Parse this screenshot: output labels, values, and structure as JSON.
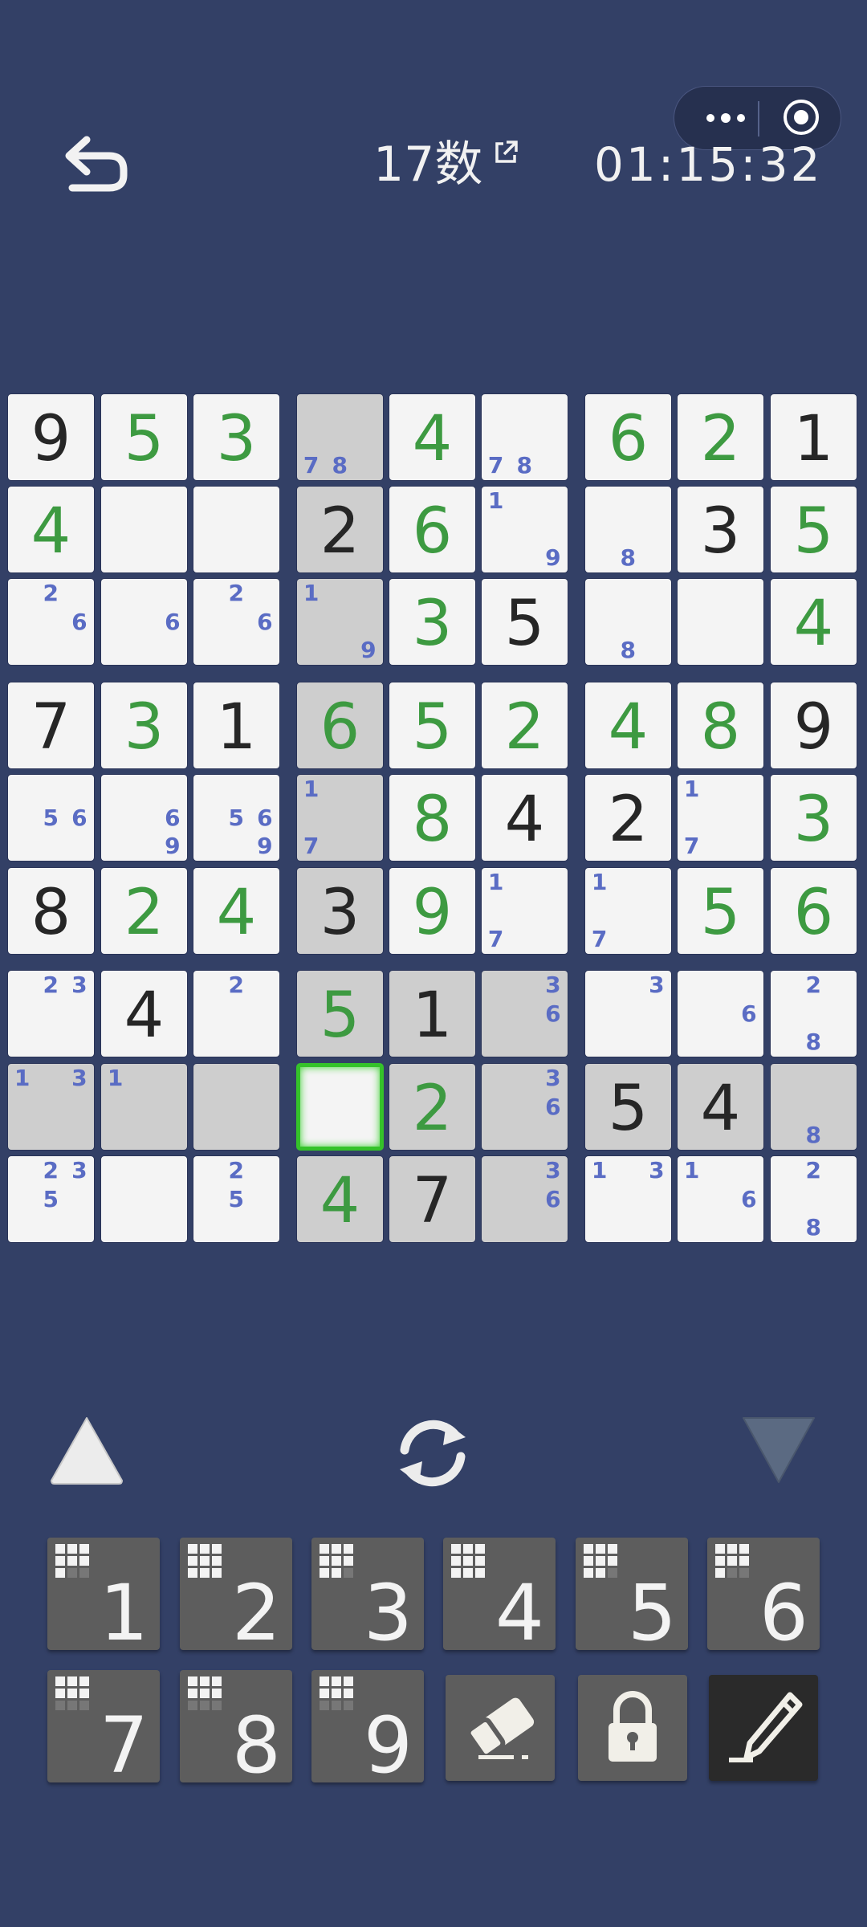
{
  "header": {
    "title": "17数",
    "timer": "01:15:32"
  },
  "grid": [
    [
      {
        "v": "9",
        "k": "given"
      },
      {
        "v": "5",
        "k": "user"
      },
      {
        "v": "3",
        "k": "user"
      },
      {
        "v": "",
        "n": [
          "7",
          "8"
        ],
        "bg": "gray"
      },
      {
        "v": "4",
        "k": "user"
      },
      {
        "v": "",
        "n": [
          "7",
          "8"
        ]
      },
      {
        "v": "6",
        "k": "user"
      },
      {
        "v": "2",
        "k": "user"
      },
      {
        "v": "1",
        "k": "given"
      }
    ],
    [
      {
        "v": "4",
        "k": "user"
      },
      {
        "v": ""
      },
      {
        "v": ""
      },
      {
        "v": "2",
        "k": "given",
        "bg": "gray"
      },
      {
        "v": "6",
        "k": "user"
      },
      {
        "v": "",
        "n": [
          "1",
          "9"
        ]
      },
      {
        "v": "",
        "n": [
          "8"
        ]
      },
      {
        "v": "3",
        "k": "given"
      },
      {
        "v": "5",
        "k": "user"
      }
    ],
    [
      {
        "v": "",
        "n": [
          "2",
          "6"
        ]
      },
      {
        "v": "",
        "n": [
          "6"
        ]
      },
      {
        "v": "",
        "n": [
          "2",
          "6"
        ]
      },
      {
        "v": "",
        "n": [
          "1",
          "9"
        ],
        "bg": "gray"
      },
      {
        "v": "3",
        "k": "user"
      },
      {
        "v": "5",
        "k": "given"
      },
      {
        "v": "",
        "n": [
          "8"
        ]
      },
      {
        "v": ""
      },
      {
        "v": "4",
        "k": "user"
      }
    ],
    [
      {
        "v": "7",
        "k": "given"
      },
      {
        "v": "3",
        "k": "user"
      },
      {
        "v": "1",
        "k": "given"
      },
      {
        "v": "6",
        "k": "user",
        "bg": "gray"
      },
      {
        "v": "5",
        "k": "user"
      },
      {
        "v": "2",
        "k": "user"
      },
      {
        "v": "4",
        "k": "user"
      },
      {
        "v": "8",
        "k": "user"
      },
      {
        "v": "9",
        "k": "given"
      }
    ],
    [
      {
        "v": "",
        "n": [
          "5",
          "6"
        ]
      },
      {
        "v": "",
        "n": [
          "6",
          "9"
        ]
      },
      {
        "v": "",
        "n": [
          "5",
          "6",
          "9"
        ]
      },
      {
        "v": "",
        "n": [
          "1",
          "7"
        ],
        "bg": "gray"
      },
      {
        "v": "8",
        "k": "user"
      },
      {
        "v": "4",
        "k": "given"
      },
      {
        "v": "2",
        "k": "given"
      },
      {
        "v": "",
        "n": [
          "1",
          "7"
        ]
      },
      {
        "v": "3",
        "k": "user"
      }
    ],
    [
      {
        "v": "8",
        "k": "given"
      },
      {
        "v": "2",
        "k": "user"
      },
      {
        "v": "4",
        "k": "user"
      },
      {
        "v": "3",
        "k": "given",
        "bg": "gray"
      },
      {
        "v": "9",
        "k": "user"
      },
      {
        "v": "",
        "n": [
          "1",
          "7"
        ]
      },
      {
        "v": "",
        "n": [
          "1",
          "7"
        ]
      },
      {
        "v": "5",
        "k": "user"
      },
      {
        "v": "6",
        "k": "user"
      }
    ],
    [
      {
        "v": "",
        "n": [
          "2",
          "3"
        ]
      },
      {
        "v": "4",
        "k": "given"
      },
      {
        "v": "",
        "n": [
          "2"
        ]
      },
      {
        "v": "5",
        "k": "user",
        "bg": "gray"
      },
      {
        "v": "1",
        "k": "given",
        "bg": "gray"
      },
      {
        "v": "",
        "n": [
          "3",
          "6"
        ],
        "bg": "gray"
      },
      {
        "v": "",
        "n": [
          "3"
        ]
      },
      {
        "v": "",
        "n": [
          "6"
        ]
      },
      {
        "v": "",
        "n": [
          "2",
          "8"
        ]
      }
    ],
    [
      {
        "v": "",
        "n": [
          "1",
          "3"
        ],
        "bg": "gray"
      },
      {
        "v": "",
        "n": [
          "1"
        ],
        "bg": "gray"
      },
      {
        "v": "",
        "bg": "gray"
      },
      {
        "v": "",
        "sel": true
      },
      {
        "v": "2",
        "k": "user",
        "bg": "gray"
      },
      {
        "v": "",
        "n": [
          "3",
          "6"
        ],
        "bg": "gray"
      },
      {
        "v": "5",
        "k": "given",
        "bg": "gray"
      },
      {
        "v": "4",
        "k": "given",
        "bg": "gray"
      },
      {
        "v": "",
        "n": [
          "8"
        ],
        "bg": "gray"
      }
    ],
    [
      {
        "v": "",
        "n": [
          "2",
          "3",
          "5"
        ]
      },
      {
        "v": ""
      },
      {
        "v": "",
        "n": [
          "2",
          "5"
        ]
      },
      {
        "v": "4",
        "k": "user",
        "bg": "gray"
      },
      {
        "v": "7",
        "k": "given",
        "bg": "gray"
      },
      {
        "v": "",
        "n": [
          "3",
          "6"
        ],
        "bg": "gray"
      },
      {
        "v": "",
        "n": [
          "1",
          "3"
        ]
      },
      {
        "v": "",
        "n": [
          "1",
          "6"
        ]
      },
      {
        "v": "",
        "n": [
          "2",
          "8"
        ]
      }
    ]
  ],
  "number_keys": [
    {
      "label": "1",
      "remaining": 2
    },
    {
      "label": "2",
      "remaining": 0
    },
    {
      "label": "3",
      "remaining": 1
    },
    {
      "label": "4",
      "remaining": 0
    },
    {
      "label": "5",
      "remaining": 1
    },
    {
      "label": "6",
      "remaining": 2
    },
    {
      "label": "7",
      "remaining": 3
    },
    {
      "label": "8",
      "remaining": 3
    },
    {
      "label": "9",
      "remaining": 3
    }
  ],
  "tools": [
    "eraser-icon",
    "lock-icon",
    "pencil-icon"
  ],
  "colors": {
    "background": "#334066",
    "given_digit": "#262626",
    "user_digit": "#3d9a41",
    "note_digit": "#5a6cc4",
    "selection": "#35c22a"
  }
}
